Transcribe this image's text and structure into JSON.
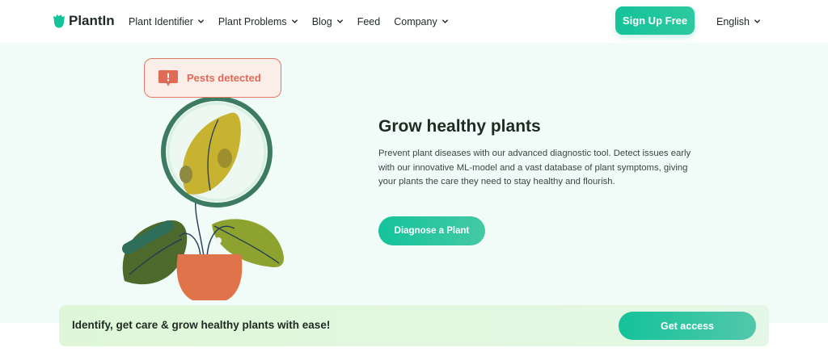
{
  "brand": {
    "name": "PlantIn",
    "color": "#14c39a"
  },
  "nav": {
    "items": [
      {
        "label": "Plant Identifier",
        "has_dropdown": true
      },
      {
        "label": "Plant Problems",
        "has_dropdown": true
      },
      {
        "label": "Blog",
        "has_dropdown": true
      },
      {
        "label": "Feed",
        "has_dropdown": false
      },
      {
        "label": "Company",
        "has_dropdown": true
      }
    ],
    "signup_label": "Sign Up Free",
    "language": "English"
  },
  "hero": {
    "badge_text": "Pests detected",
    "title": "Grow healthy plants",
    "description": "Prevent plant diseases with our advanced diagnostic tool. Detect issues early with our innovative ML-model and a vast database of plant symptoms, giving your plants the care they need to stay healthy and flourish.",
    "cta_label": "Diagnose a Plant"
  },
  "banner": {
    "text": "Identify, get care & grow healthy plants with ease!",
    "cta_label": "Get access"
  },
  "icons": [
    "plantin-logo-icon",
    "chevron-down-icon",
    "alert-icon"
  ],
  "colors": {
    "accent": "#14c39a",
    "alert": "#e06a55",
    "hero_bg": "#f1fbf7",
    "banner_bg": "#dff7d8"
  }
}
